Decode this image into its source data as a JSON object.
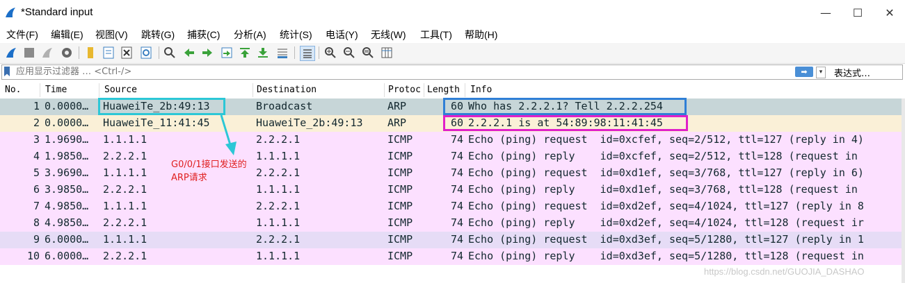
{
  "window": {
    "title": "*Standard input",
    "minimize": "—",
    "maximize": "☐",
    "close": "✕"
  },
  "menu": [
    "文件(F)",
    "编辑(E)",
    "视图(V)",
    "跳转(G)",
    "捕获(C)",
    "分析(A)",
    "统计(S)",
    "电话(Y)",
    "无线(W)",
    "工具(T)",
    "帮助(H)"
  ],
  "filter": {
    "placeholder": "应用显示过滤器 … <Ctrl-/>",
    "apply": "➡",
    "dropdown": "▾",
    "expression": "表达式…"
  },
  "columns": [
    "No.",
    "Time",
    "Source",
    "Destination",
    "Protoc",
    "Length",
    "Info"
  ],
  "packets": [
    {
      "no": "1",
      "time": "0.0000…",
      "source": "HuaweiTe_2b:49:13",
      "destination": "Broadcast",
      "protocol": "ARP",
      "length": "60",
      "info": "Who has 2.2.2.1? Tell 2.2.2.254",
      "bg": "#c7d6d8"
    },
    {
      "no": "2",
      "time": "0.0000…",
      "source": "HuaweiTe_11:41:45",
      "destination": "HuaweiTe_2b:49:13",
      "protocol": "ARP",
      "length": "60",
      "info": "2.2.2.1 is at 54:89:98:11:41:45",
      "bg": "#faf0d7"
    },
    {
      "no": "3",
      "time": "1.9690…",
      "source": "1.1.1.1",
      "destination": "2.2.2.1",
      "protocol": "ICMP",
      "length": "74",
      "info": "Echo (ping) request  id=0xcfef, seq=2/512, ttl=127 (reply in 4)",
      "bg": "#fce0ff"
    },
    {
      "no": "4",
      "time": "1.9850…",
      "source": "2.2.2.1",
      "destination": "1.1.1.1",
      "protocol": "ICMP",
      "length": "74",
      "info": "Echo (ping) reply    id=0xcfef, seq=2/512, ttl=128 (request in",
      "bg": "#fce0ff"
    },
    {
      "no": "5",
      "time": "3.9690…",
      "source": "1.1.1.1",
      "destination": "2.2.2.1",
      "protocol": "ICMP",
      "length": "74",
      "info": "Echo (ping) request  id=0xd1ef, seq=3/768, ttl=127 (reply in 6)",
      "bg": "#fce0ff"
    },
    {
      "no": "6",
      "time": "3.9850…",
      "source": "2.2.2.1",
      "destination": "1.1.1.1",
      "protocol": "ICMP",
      "length": "74",
      "info": "Echo (ping) reply    id=0xd1ef, seq=3/768, ttl=128 (request in",
      "bg": "#fce0ff"
    },
    {
      "no": "7",
      "time": "4.9850…",
      "source": "1.1.1.1",
      "destination": "2.2.2.1",
      "protocol": "ICMP",
      "length": "74",
      "info": "Echo (ping) request  id=0xd2ef, seq=4/1024, ttl=127 (reply in 8",
      "bg": "#fce0ff"
    },
    {
      "no": "8",
      "time": "4.9850…",
      "source": "2.2.2.1",
      "destination": "1.1.1.1",
      "protocol": "ICMP",
      "length": "74",
      "info": "Echo (ping) reply    id=0xd2ef, seq=4/1024, ttl=128 (request ir",
      "bg": "#fce0ff"
    },
    {
      "no": "9",
      "time": "6.0000…",
      "source": "1.1.1.1",
      "destination": "2.2.2.1",
      "protocol": "ICMP",
      "length": "74",
      "info": "Echo (ping) request  id=0xd3ef, seq=5/1280, ttl=127 (reply in 1",
      "bg": "#e6dcf6"
    },
    {
      "no": "10",
      "time": "6.0000…",
      "source": "2.2.2.1",
      "destination": "1.1.1.1",
      "protocol": "ICMP",
      "length": "74",
      "info": "Echo (ping) reply    id=0xd3ef, seq=5/1280, ttl=128 (request in",
      "bg": "#fce0ff"
    }
  ],
  "annotation": {
    "text": "G0/0/1接口发送的ARP请求",
    "color": "#e02020",
    "arrow_color": "#2cc7d6"
  },
  "highlights": {
    "source_box": "#2cc7d6",
    "request_box": "#2f7fd6",
    "reply_box": "#e020c8"
  },
  "watermark": "https://blog.csdn.net/GUOJIA_DASHAO"
}
